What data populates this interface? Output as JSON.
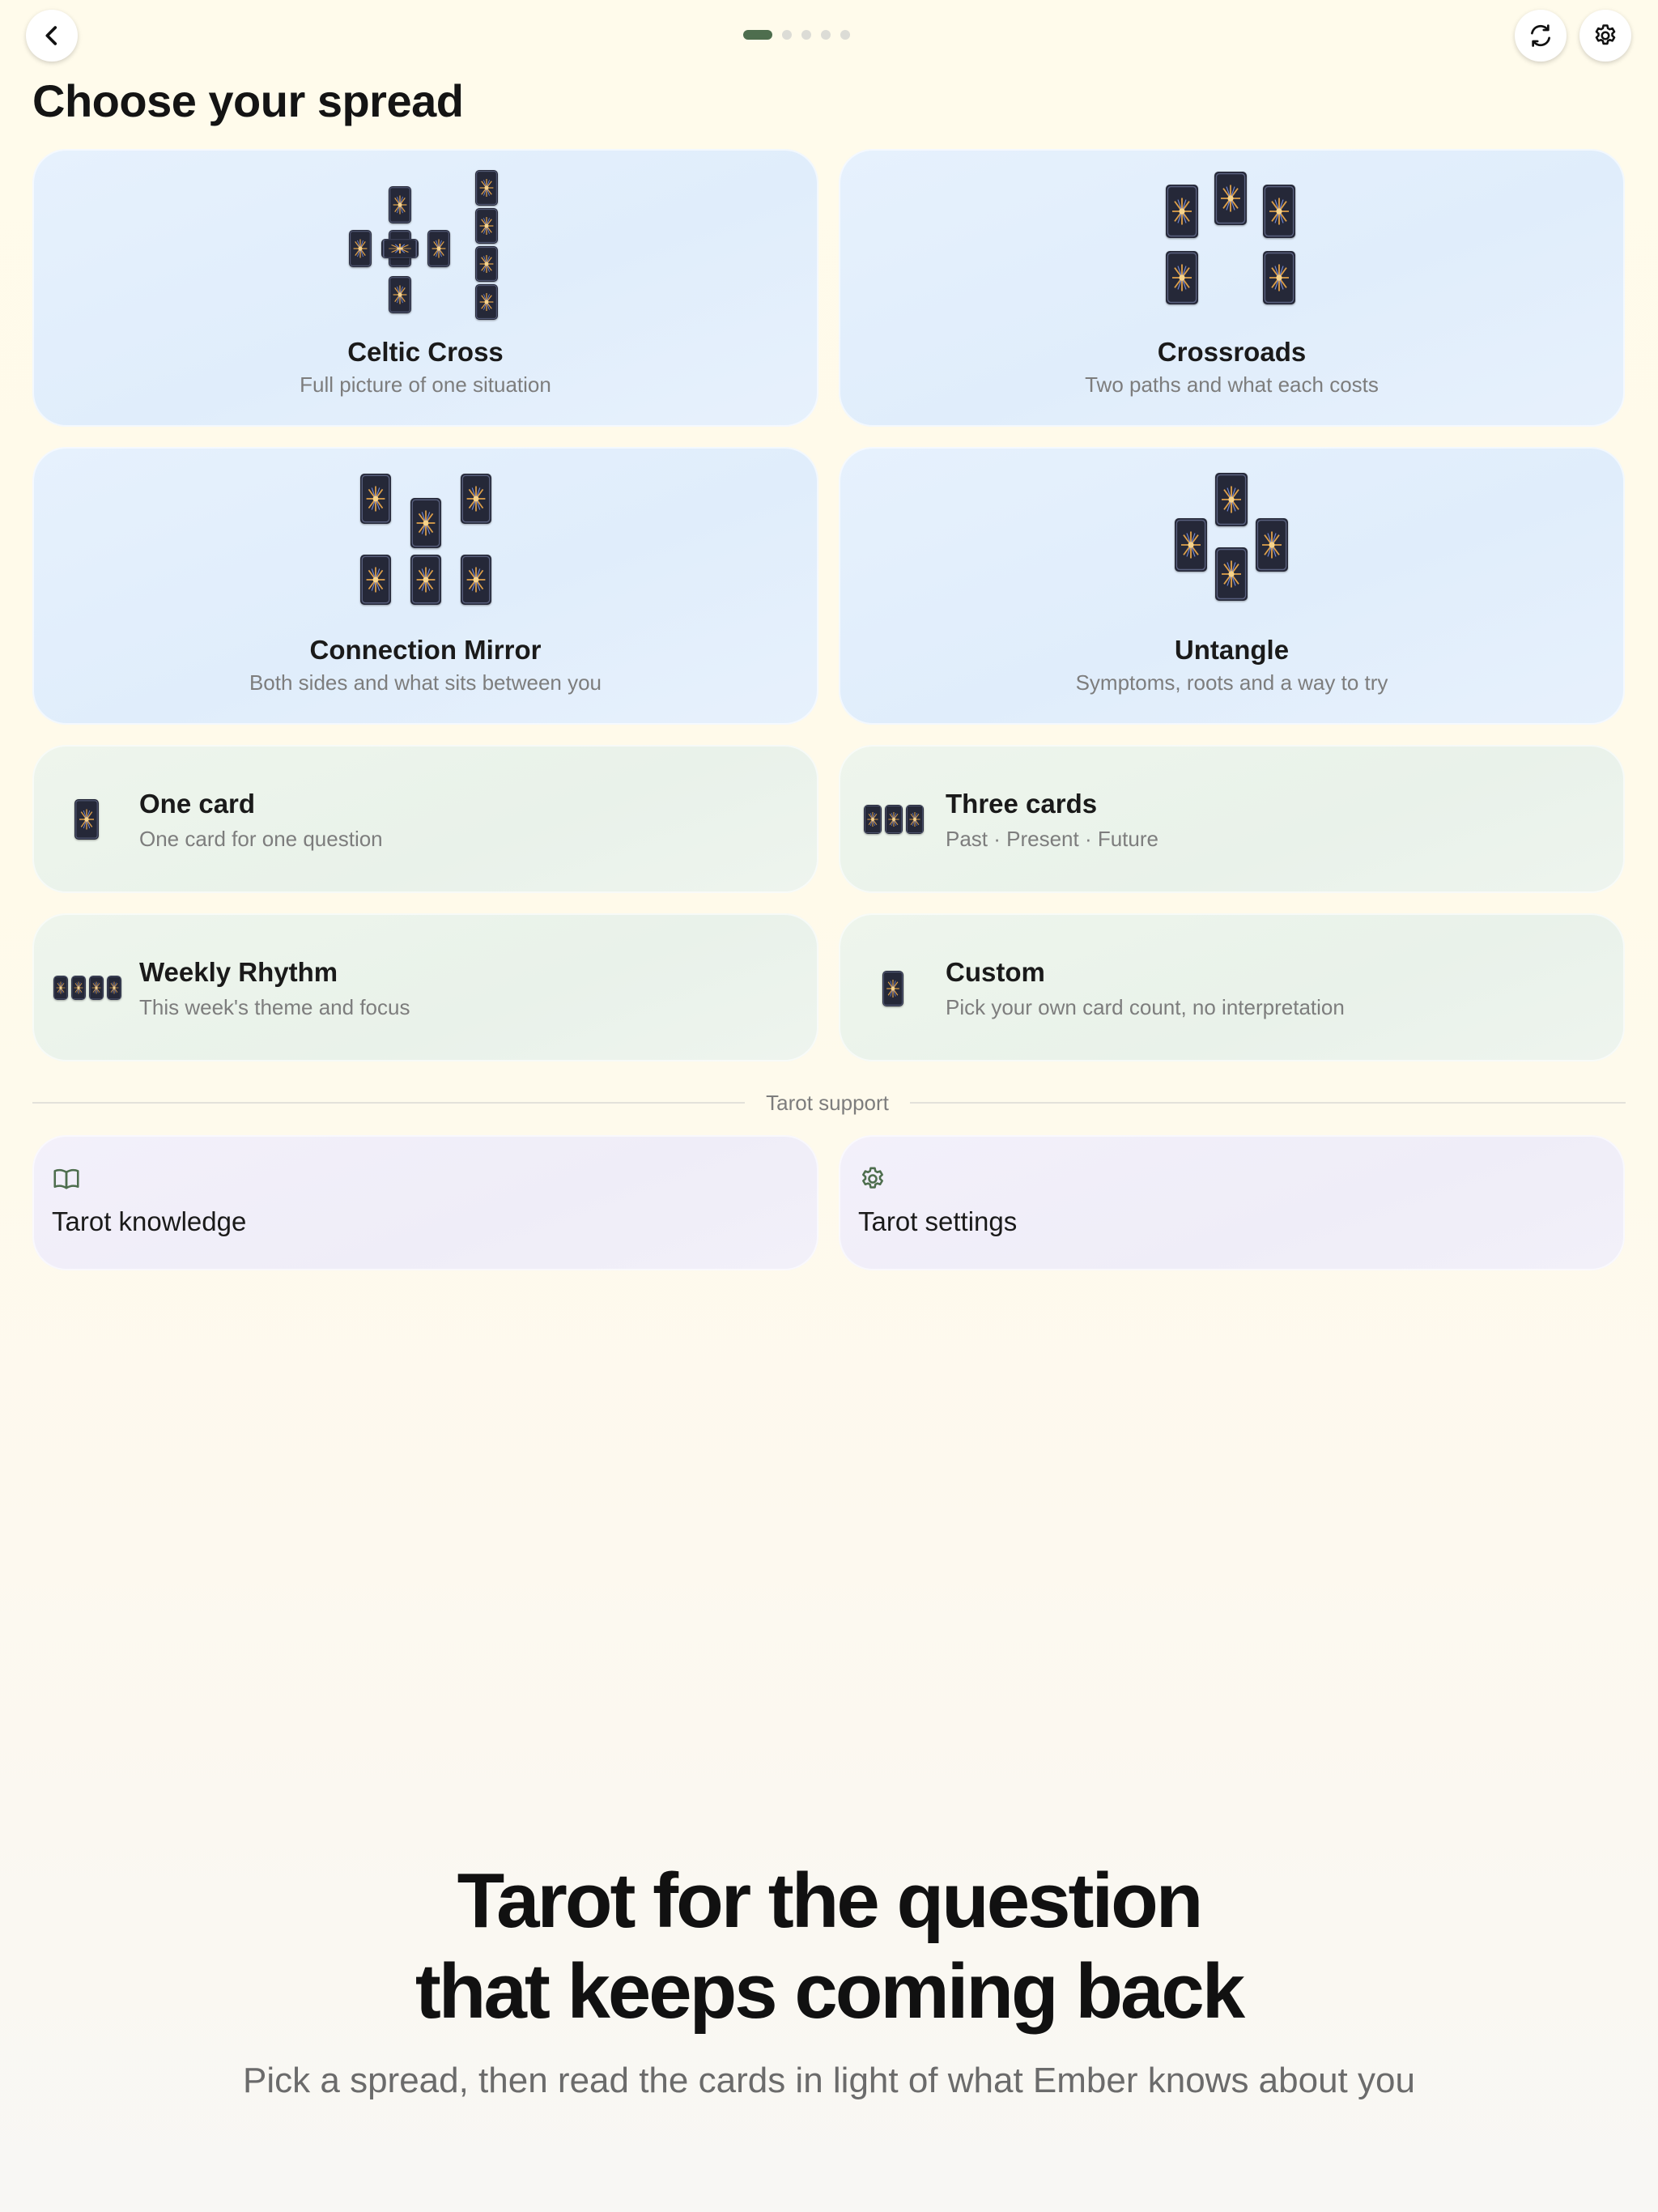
{
  "header": {
    "back_icon": "chevron-left-icon",
    "refresh_icon": "refresh-icon",
    "settings_icon": "gear-icon",
    "pager": {
      "count": 5,
      "active_index": 0
    },
    "accent_color": "#4e6e4e"
  },
  "page_title": "Choose your spread",
  "spreads": {
    "celtic_cross": {
      "title": "Celtic Cross",
      "subtitle": "Full picture of one situation"
    },
    "crossroads": {
      "title": "Crossroads",
      "subtitle": "Two paths and what each costs"
    },
    "connection_mirror": {
      "title": "Connection Mirror",
      "subtitle": "Both sides and what sits between you"
    },
    "untangle": {
      "title": "Untangle",
      "subtitle": "Symptoms, roots and a way to try"
    },
    "one_card": {
      "title": "One card",
      "subtitle": "One card for one question"
    },
    "three_cards": {
      "title": "Three cards",
      "subtitle": "Past · Present · Future"
    },
    "weekly_rhythm": {
      "title": "Weekly Rhythm",
      "subtitle": "This week's theme and focus"
    },
    "custom": {
      "title": "Custom",
      "subtitle": "Pick your own card count, no interpretation"
    }
  },
  "support": {
    "divider_label": "Tarot support",
    "knowledge": {
      "label": "Tarot knowledge",
      "icon": "open-book-icon"
    },
    "settings": {
      "label": "Tarot settings",
      "icon": "gear-icon"
    }
  },
  "hero": {
    "title_line1": "Tarot for the question",
    "title_line2": "that keeps coming back",
    "subtitle": "Pick a spread, then read the cards in light of what Ember knows about you"
  }
}
